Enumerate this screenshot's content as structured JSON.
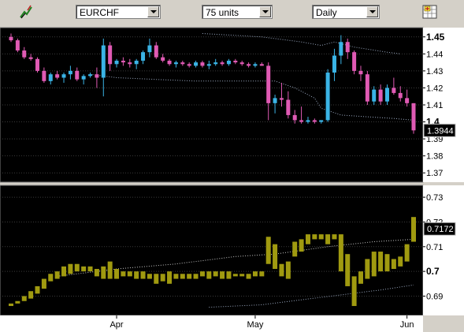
{
  "toolbar": {
    "symbol": "EURCHF",
    "units": "75 units",
    "period": "Daily"
  },
  "chart_data": [
    {
      "type": "candlestick",
      "panel": "price",
      "ylim": [
        1.365,
        1.455
      ],
      "yticks": [
        "1.45",
        "1.44",
        "1.43",
        "1.42",
        "1.41",
        "1.4",
        "1.39",
        "1.38",
        "1.37"
      ],
      "last_value_label": "1.3944",
      "colors": {
        "up": "#3ab4e6",
        "down": "#e05ab4",
        "doji": "#d070c0"
      },
      "candles": [
        [
          1.45,
          1.452,
          1.447,
          1.448
        ],
        [
          1.448,
          1.449,
          1.441,
          1.442
        ],
        [
          1.442,
          1.444,
          1.437,
          1.438
        ],
        [
          1.438,
          1.44,
          1.436,
          1.437
        ],
        [
          1.437,
          1.438,
          1.429,
          1.43
        ],
        [
          1.43,
          1.432,
          1.423,
          1.424
        ],
        [
          1.424,
          1.429,
          1.422,
          1.428
        ],
        [
          1.428,
          1.43,
          1.425,
          1.426
        ],
        [
          1.426,
          1.429,
          1.423,
          1.428
        ],
        [
          1.428,
          1.433,
          1.425,
          1.43
        ],
        [
          1.43,
          1.432,
          1.424,
          1.425
        ],
        [
          1.425,
          1.428,
          1.422,
          1.427
        ],
        [
          1.427,
          1.429,
          1.426,
          1.428
        ],
        [
          1.428,
          1.432,
          1.42,
          1.426
        ],
        [
          1.426,
          1.449,
          1.415,
          1.445
        ],
        [
          1.445,
          1.447,
          1.43,
          1.434
        ],
        [
          1.434,
          1.437,
          1.432,
          1.436
        ],
        [
          1.436,
          1.438,
          1.433,
          1.435
        ],
        [
          1.435,
          1.437,
          1.432,
          1.434
        ],
        [
          1.434,
          1.437,
          1.431,
          1.436
        ],
        [
          1.436,
          1.442,
          1.434,
          1.441
        ],
        [
          1.441,
          1.449,
          1.438,
          1.445
        ],
        [
          1.445,
          1.447,
          1.437,
          1.438
        ],
        [
          1.438,
          1.44,
          1.435,
          1.436
        ],
        [
          1.436,
          1.437,
          1.433,
          1.434
        ],
        [
          1.434,
          1.436,
          1.432,
          1.435
        ],
        [
          1.435,
          1.436,
          1.433,
          1.434
        ],
        [
          1.434,
          1.435,
          1.432,
          1.433
        ],
        [
          1.433,
          1.436,
          1.432,
          1.435
        ],
        [
          1.435,
          1.436,
          1.432,
          1.433
        ],
        [
          1.433,
          1.436,
          1.431,
          1.434
        ],
        [
          1.434,
          1.437,
          1.433,
          1.435
        ],
        [
          1.435,
          1.436,
          1.433,
          1.434
        ],
        [
          1.434,
          1.437,
          1.433,
          1.436
        ],
        [
          1.436,
          1.437,
          1.434,
          1.435
        ],
        [
          1.435,
          1.436,
          1.433,
          1.434
        ],
        [
          1.434,
          1.435,
          1.432,
          1.433
        ],
        [
          1.433,
          1.435,
          1.432,
          1.434
        ],
        [
          1.434,
          1.435,
          1.433,
          1.433
        ],
        [
          1.433,
          1.435,
          1.401,
          1.411
        ],
        [
          1.411,
          1.416,
          1.405,
          1.414
        ],
        [
          1.414,
          1.423,
          1.409,
          1.413
        ],
        [
          1.413,
          1.418,
          1.402,
          1.404
        ],
        [
          1.404,
          1.407,
          1.399,
          1.401
        ],
        [
          1.401,
          1.409,
          1.399,
          1.4
        ],
        [
          1.4,
          1.403,
          1.399,
          1.401
        ],
        [
          1.401,
          1.402,
          1.399,
          1.4
        ],
        [
          1.4,
          1.401,
          1.399,
          1.401
        ],
        [
          1.401,
          1.431,
          1.4,
          1.429
        ],
        [
          1.429,
          1.443,
          1.424,
          1.439
        ],
        [
          1.439,
          1.451,
          1.434,
          1.447
        ],
        [
          1.447,
          1.449,
          1.437,
          1.441
        ],
        [
          1.441,
          1.442,
          1.428,
          1.43
        ],
        [
          1.43,
          1.433,
          1.424,
          1.428
        ],
        [
          1.428,
          1.43,
          1.41,
          1.412
        ],
        [
          1.412,
          1.421,
          1.41,
          1.419
        ],
        [
          1.419,
          1.422,
          1.41,
          1.412
        ],
        [
          1.412,
          1.422,
          1.41,
          1.42
        ],
        [
          1.42,
          1.426,
          1.416,
          1.417
        ],
        [
          1.417,
          1.421,
          1.412,
          1.414
        ],
        [
          1.414,
          1.419,
          1.409,
          1.411
        ],
        [
          1.411,
          1.411,
          1.393,
          1.395
        ]
      ],
      "overlays": [
        {
          "style": "dotted",
          "color": "#9aa8c0",
          "points": [
            [
              29,
              1.452
            ],
            [
              38,
              1.45
            ],
            [
              44,
              1.447
            ],
            [
              47,
              1.445
            ],
            [
              49,
              1.447
            ],
            [
              52,
              1.444
            ],
            [
              57,
              1.441
            ],
            [
              59,
              1.44
            ]
          ]
        },
        {
          "style": "dotted",
          "color": "#9aa8c0",
          "points": [
            [
              12,
              1.428
            ],
            [
              16,
              1.426
            ],
            [
              22,
              1.425
            ],
            [
              28,
              1.424
            ],
            [
              34,
              1.424
            ],
            [
              40,
              1.424
            ],
            [
              43,
              1.42
            ],
            [
              46,
              1.414
            ],
            [
              47,
              1.408
            ],
            [
              50,
              1.404
            ],
            [
              54,
              1.403
            ],
            [
              58,
              1.402
            ],
            [
              61,
              1.401
            ]
          ]
        }
      ]
    },
    {
      "type": "bar",
      "panel": "indicator",
      "ylim": [
        0.6825,
        0.7345
      ],
      "yticks": [
        "0.73",
        "0.72",
        "0.71",
        "0.7",
        "0.69"
      ],
      "last_value_label": "0.7172",
      "bar_color": "#a09a10",
      "bars": [
        [
          0.686,
          0.687
        ],
        [
          0.687,
          0.688
        ],
        [
          0.688,
          0.69
        ],
        [
          0.689,
          0.692
        ],
        [
          0.691,
          0.694
        ],
        [
          0.693,
          0.697
        ],
        [
          0.696,
          0.699
        ],
        [
          0.697,
          0.7
        ],
        [
          0.698,
          0.702
        ],
        [
          0.699,
          0.703
        ],
        [
          0.7,
          0.703
        ],
        [
          0.7,
          0.702
        ],
        [
          0.7,
          0.702
        ],
        [
          0.698,
          0.701
        ],
        [
          0.697,
          0.702
        ],
        [
          0.697,
          0.704
        ],
        [
          0.697,
          0.701
        ],
        [
          0.698,
          0.7
        ],
        [
          0.698,
          0.7
        ],
        [
          0.697,
          0.7
        ],
        [
          0.697,
          0.7
        ],
        [
          0.697,
          0.699
        ],
        [
          0.695,
          0.699
        ],
        [
          0.696,
          0.699
        ],
        [
          0.695,
          0.7
        ],
        [
          0.697,
          0.699
        ],
        [
          0.697,
          0.699
        ],
        [
          0.697,
          0.699
        ],
        [
          0.697,
          0.699
        ],
        [
          0.698,
          0.7
        ],
        [
          0.697,
          0.7
        ],
        [
          0.698,
          0.7
        ],
        [
          0.697,
          0.7
        ],
        [
          0.697,
          0.7
        ],
        [
          0.698,
          0.699
        ],
        [
          0.698,
          0.699
        ],
        [
          0.697,
          0.699
        ],
        [
          0.698,
          0.7
        ],
        [
          0.698,
          0.7
        ],
        [
          0.703,
          0.714
        ],
        [
          0.701,
          0.711
        ],
        [
          0.698,
          0.703
        ],
        [
          0.697,
          0.704
        ],
        [
          0.706,
          0.712
        ],
        [
          0.708,
          0.713
        ],
        [
          0.711,
          0.715
        ],
        [
          0.713,
          0.715
        ],
        [
          0.713,
          0.715
        ],
        [
          0.711,
          0.715
        ],
        [
          0.713,
          0.715
        ],
        [
          0.7,
          0.715
        ],
        [
          0.694,
          0.707
        ],
        [
          0.686,
          0.698
        ],
        [
          0.695,
          0.7
        ],
        [
          0.697,
          0.705
        ],
        [
          0.698,
          0.708
        ],
        [
          0.7,
          0.708
        ],
        [
          0.7,
          0.707
        ],
        [
          0.701,
          0.705
        ],
        [
          0.702,
          0.706
        ],
        [
          0.704,
          0.711
        ],
        [
          0.712,
          0.722
        ]
      ],
      "overlays": [
        {
          "style": "dotted",
          "color": "#c8c8c8",
          "points": [
            [
              7,
              0.698
            ],
            [
              16,
              0.701
            ],
            [
              25,
              0.703
            ],
            [
              34,
              0.706
            ],
            [
              40,
              0.707
            ],
            [
              48,
              0.71
            ],
            [
              55,
              0.712
            ],
            [
              61,
              0.713
            ]
          ]
        },
        {
          "style": "dotted",
          "color": "#9aa8c0",
          "points": [
            [
              30,
              0.6855
            ],
            [
              38,
              0.6865
            ],
            [
              44,
              0.6885
            ],
            [
              50,
              0.6905
            ],
            [
              56,
              0.6925
            ],
            [
              61,
              0.6945
            ]
          ]
        }
      ]
    }
  ],
  "xticks": [
    {
      "label": "Apr",
      "index": 16
    },
    {
      "label": "May",
      "index": 37
    },
    {
      "label": "Jun",
      "index": 60
    }
  ]
}
